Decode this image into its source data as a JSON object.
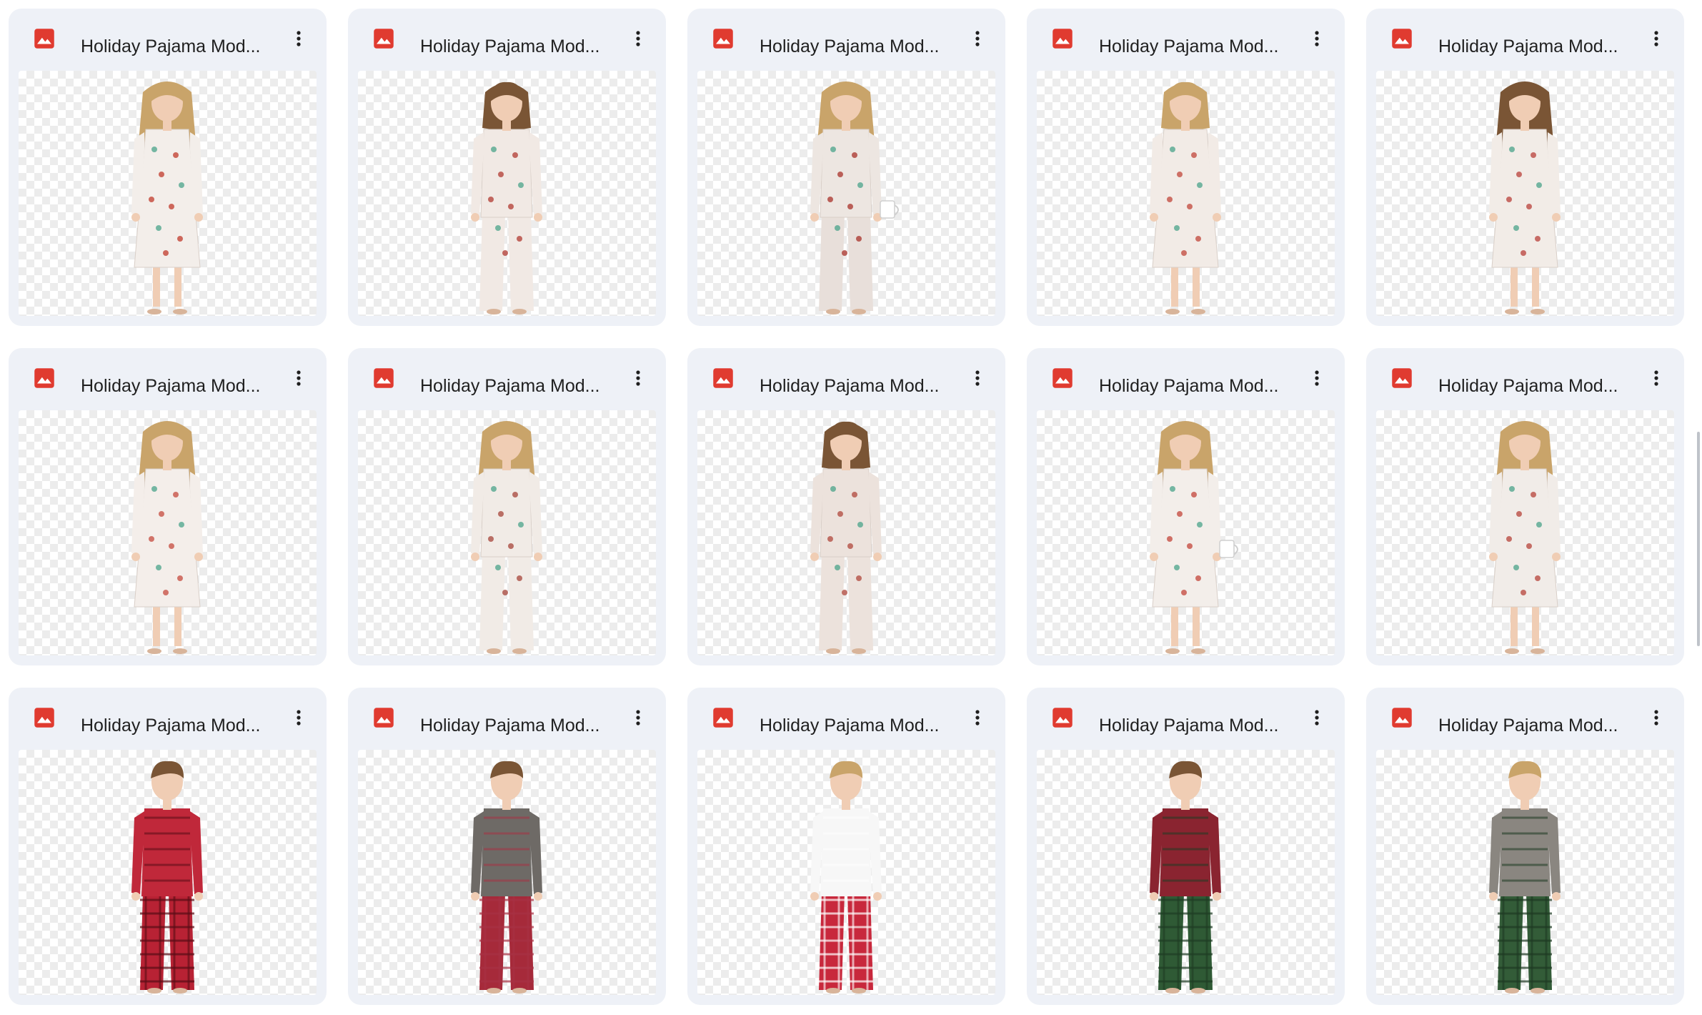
{
  "file_grid": {
    "cards": [
      {
        "name": "Holiday Pajama Mod...",
        "icon": "image-file-icon",
        "thumbnail": {
          "subject": "girl",
          "outfit": "dress",
          "hair": "long",
          "prop": "",
          "top": "#f3eeea",
          "bottom": "#f3eeea",
          "accent": "#c0392b"
        }
      },
      {
        "name": "Holiday Pajama Mod...",
        "icon": "image-file-icon",
        "thumbnail": {
          "subject": "girl",
          "outfit": "onesie",
          "hair": "shoulder",
          "prop": "",
          "top": "#f1e9e4",
          "bottom": "#f1e9e4",
          "accent": "#b03a32"
        }
      },
      {
        "name": "Holiday Pajama Mod...",
        "icon": "image-file-icon",
        "thumbnail": {
          "subject": "girl",
          "outfit": "onesie",
          "hair": "long",
          "prop": "mug",
          "top": "#ede6e1",
          "bottom": "#e8dfda",
          "accent": "#a8322a"
        }
      },
      {
        "name": "Holiday Pajama Mod...",
        "icon": "image-file-icon",
        "thumbnail": {
          "subject": "girl",
          "outfit": "dress",
          "hair": "shoulder",
          "prop": "",
          "top": "#f2ebe6",
          "bottom": "#f2ebe6",
          "accent": "#c0463a"
        }
      },
      {
        "name": "Holiday Pajama Mod...",
        "icon": "image-file-icon",
        "thumbnail": {
          "subject": "girl",
          "outfit": "dress",
          "hair": "long",
          "prop": "",
          "top": "#f2ece7",
          "bottom": "#f2ece7",
          "accent": "#b8403a"
        }
      },
      {
        "name": "Holiday Pajama Mod...",
        "icon": "image-file-icon",
        "thumbnail": {
          "subject": "girl",
          "outfit": "dress",
          "hair": "long",
          "prop": "",
          "top": "#f4eeea",
          "bottom": "#f4eeea",
          "accent": "#c54a3d"
        }
      },
      {
        "name": "Holiday Pajama Mod...",
        "icon": "image-file-icon",
        "thumbnail": {
          "subject": "girl",
          "outfit": "onesie",
          "hair": "long",
          "prop": "",
          "top": "#f1ebe6",
          "bottom": "#f1ebe6",
          "accent": "#a6443a"
        }
      },
      {
        "name": "Holiday Pajama Mod...",
        "icon": "image-file-icon",
        "thumbnail": {
          "subject": "girl",
          "outfit": "onesie",
          "hair": "shoulder",
          "prop": "",
          "top": "#ece2dc",
          "bottom": "#ece2dc",
          "accent": "#b0473c"
        }
      },
      {
        "name": "Holiday Pajama Mod...",
        "icon": "image-file-icon",
        "thumbnail": {
          "subject": "girl",
          "outfit": "dress",
          "hair": "long",
          "prop": "mug",
          "top": "#f3eeea",
          "bottom": "#f3eeea",
          "accent": "#c3443a"
        }
      },
      {
        "name": "Holiday Pajama Mod...",
        "icon": "image-file-icon",
        "thumbnail": {
          "subject": "girl",
          "outfit": "dress",
          "hair": "long",
          "prop": "",
          "top": "#f1ece8",
          "bottom": "#f1ece8",
          "accent": "#b6433a"
        }
      },
      {
        "name": "Holiday Pajama Mod...",
        "icon": "image-file-icon",
        "thumbnail": {
          "subject": "boy",
          "outfit": "pajama-set",
          "hair": "short",
          "prop": "",
          "top": "#c0283a",
          "bottom": "#b82234",
          "accent": "#5a0d16"
        }
      },
      {
        "name": "Holiday Pajama Mod...",
        "icon": "image-file-icon",
        "thumbnail": {
          "subject": "boy",
          "outfit": "pajama-set",
          "hair": "medium",
          "prop": "",
          "top": "#6e6a66",
          "bottom": "#a62a3a",
          "accent": "#a83244"
        }
      },
      {
        "name": "Holiday Pajama Mod...",
        "icon": "image-file-icon",
        "thumbnail": {
          "subject": "boy",
          "outfit": "pajama-set",
          "hair": "short",
          "prop": "",
          "top": "#f7f7f7",
          "bottom": "#c8283c",
          "accent": "#ffffff"
        }
      },
      {
        "name": "Holiday Pajama Mod...",
        "icon": "image-file-icon",
        "thumbnail": {
          "subject": "boy",
          "outfit": "pajama-set",
          "hair": "medium",
          "prop": "",
          "top": "#8a2430",
          "bottom": "#2f5a35",
          "accent": "#1f3d24"
        }
      },
      {
        "name": "Holiday Pajama Mod...",
        "icon": "image-file-icon",
        "thumbnail": {
          "subject": "boy",
          "outfit": "pajama-set",
          "hair": "short",
          "prop": "",
          "top": "#8a8680",
          "bottom": "#335c38",
          "accent": "#1e3a23"
        }
      }
    ]
  },
  "colors": {
    "card_bg": "#eef1f7",
    "icon_red": "#e03b30",
    "text": "#1f1f1f",
    "skin": "#f0cdb4",
    "hair_blonde": "#c9a46a",
    "hair_brown": "#7a5535"
  }
}
